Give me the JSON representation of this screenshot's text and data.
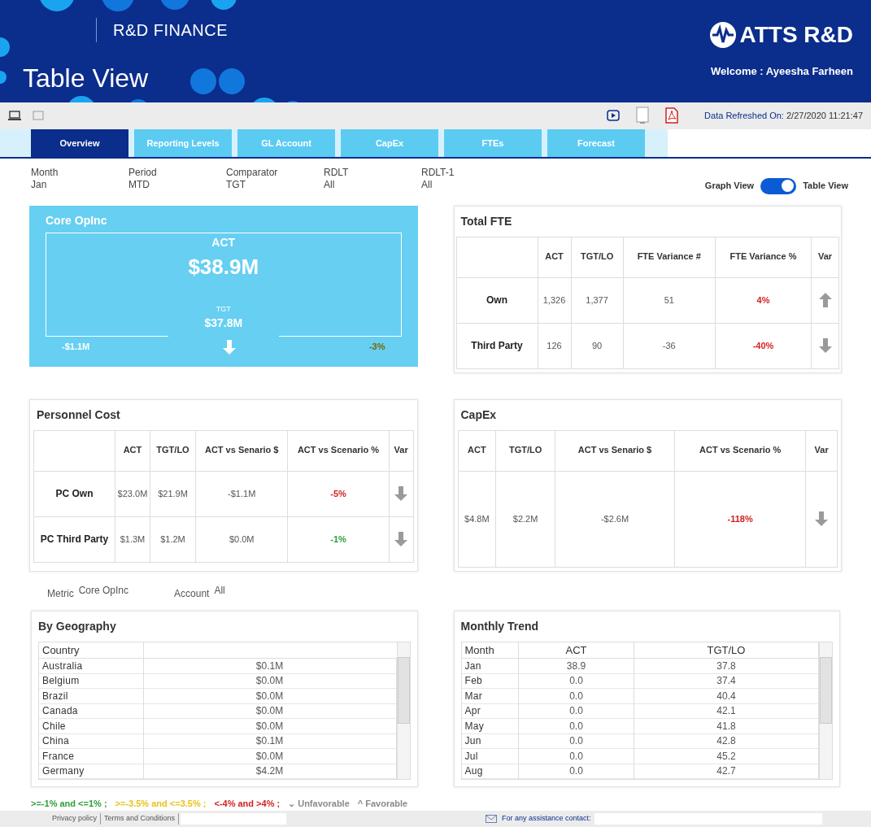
{
  "header": {
    "section": "R&D FINANCE",
    "title": "Table View",
    "logo": "ATTS R&D",
    "welcome": "Welcome : Ayeesha Farheen"
  },
  "toolbar": {
    "refreshed_label": "Data Refreshed On:",
    "refreshed_value": "2/27/2020 11:21:47"
  },
  "tabs": [
    {
      "label": "Overview",
      "selected": true
    },
    {
      "label": "Reporting Levels",
      "selected": false
    },
    {
      "label": "GL Account",
      "selected": false
    },
    {
      "label": "CapEx",
      "selected": false
    },
    {
      "label": "FTEs",
      "selected": false
    },
    {
      "label": "Forecast",
      "selected": false
    }
  ],
  "filters": [
    {
      "label": "Month",
      "value": "Jan"
    },
    {
      "label": "Period",
      "value": "MTD"
    },
    {
      "label": "Comparator",
      "value": "TGT"
    },
    {
      "label": "RDLT",
      "value": "All"
    },
    {
      "label": "RDLT-1",
      "value": "All"
    }
  ],
  "view_toggle": {
    "left": "Graph View",
    "right": "Table View",
    "on": true
  },
  "core_opinc": {
    "title": "Core OpInc",
    "act_label": "ACT",
    "act_value": "$38.9M",
    "tgt_label": "TGT",
    "tgt_value": "$37.8M",
    "variance": "-$1.1M",
    "variance_pct": "-3%",
    "up": false
  },
  "total_fte": {
    "title": "Total FTE",
    "columns": [
      "",
      "ACT",
      "TGT/LO",
      "FTE Variance #",
      "FTE Variance %",
      "Var"
    ],
    "rows": [
      {
        "cells": [
          "Own",
          "1,326",
          "1,377",
          "51",
          "4%"
        ],
        "color": "#d21f1f",
        "up": true
      },
      {
        "cells": [
          "Third Party",
          "126",
          "90",
          "-36",
          "-40%"
        ],
        "color": "#d21f1f",
        "up": false
      }
    ]
  },
  "personnel_cost": {
    "title": "Personnel Cost",
    "columns": [
      "",
      "ACT",
      "TGT/LO",
      "ACT vs Senario $",
      "ACT vs Scenario %",
      "Var"
    ],
    "rows": [
      {
        "cells": [
          "PC Own",
          "$23.0M",
          "$21.9M",
          "-$1.1M",
          "-5%"
        ],
        "color": "#d21f1f",
        "up": false
      },
      {
        "cells": [
          "PC Third Party",
          "$1.3M",
          "$1.2M",
          "$0.0M",
          "-1%"
        ],
        "color": "#2e9e3a",
        "up": false
      }
    ]
  },
  "capex": {
    "title": "CapEx",
    "columns": [
      "ACT",
      "TGT/LO",
      "ACT vs Senario $",
      "ACT vs Scenario %",
      "Var"
    ],
    "rows": [
      {
        "cells": [
          "$4.8M",
          "$2.2M",
          "-$2.6M",
          "-118%"
        ],
        "color": "#d21f1f",
        "up": false
      }
    ]
  },
  "selectors": [
    {
      "label": "Metric",
      "value": "Core OpInc"
    },
    {
      "label": "Account",
      "value": "All"
    }
  ],
  "by_geography": {
    "title": "By Geography",
    "columns": [
      "Country"
    ],
    "rows": [
      [
        "Australia",
        "$0.1M"
      ],
      [
        "Belgium",
        "$0.0M"
      ],
      [
        "Brazil",
        "$0.0M"
      ],
      [
        "Canada",
        "$0.0M"
      ],
      [
        "Chile",
        "$0.0M"
      ],
      [
        "China",
        "$0.1M"
      ],
      [
        "France",
        "$0.0M"
      ],
      [
        "Germany",
        "$4.2M"
      ]
    ]
  },
  "monthly_trend": {
    "title": "Monthly Trend",
    "columns": [
      "Month",
      "ACT",
      "TGT/LO"
    ],
    "rows": [
      [
        "Jan",
        "38.9",
        "37.8"
      ],
      [
        "Feb",
        "0.0",
        "37.4"
      ],
      [
        "Mar",
        "0.0",
        "40.4"
      ],
      [
        "Apr",
        "0.0",
        "42.1"
      ],
      [
        "May",
        "0.0",
        "41.8"
      ],
      [
        "Jun",
        "0.0",
        "42.8"
      ],
      [
        "Jul",
        "0.0",
        "45.2"
      ],
      [
        "Aug",
        "0.0",
        "42.7"
      ]
    ]
  },
  "legend": [
    {
      "text": ">=-1% and <=1% ;",
      "color": "#2e9e3a"
    },
    {
      "text": ">=-3.5% and <=3.5% ;",
      "color": "#e8c21a"
    },
    {
      "text": "<-4% and >4% ;",
      "color": "#d21f1f"
    },
    {
      "text": "⌄ Unfavorable",
      "color": "#8a8a8a"
    },
    {
      "text": "^ Favorable",
      "color": "#8a8a8a"
    }
  ],
  "footer": {
    "links": [
      "Privacy policy",
      "Terms and Conditions"
    ],
    "contact": "For any assistance contact:"
  }
}
